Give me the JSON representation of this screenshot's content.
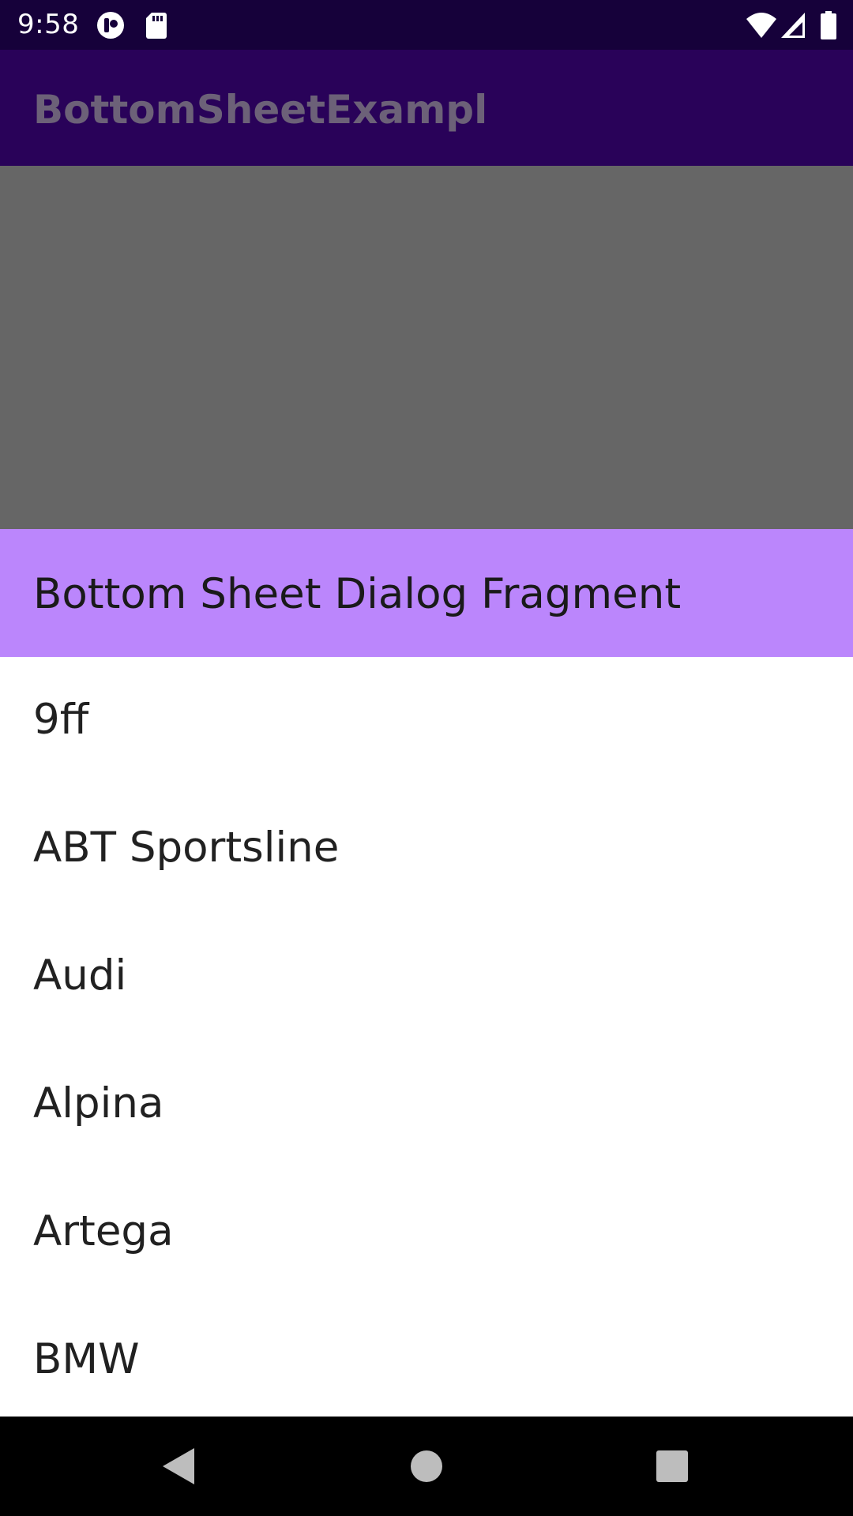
{
  "status_bar": {
    "time": "9:58",
    "left_icons": [
      "sync-app-icon",
      "sd-card-icon"
    ],
    "right_icons": [
      "wifi-icon",
      "cell-signal-icon",
      "battery-icon"
    ]
  },
  "app_bar": {
    "title": "BottomSheetExampl"
  },
  "sheet": {
    "title": "Bottom Sheet Dialog Fragment",
    "items": [
      {
        "label": "9ff"
      },
      {
        "label": "ABT Sportsline"
      },
      {
        "label": "Audi"
      },
      {
        "label": "Alpina"
      },
      {
        "label": "Artega"
      },
      {
        "label": "BMW"
      }
    ]
  },
  "nav_bar": {
    "buttons": [
      "back-icon",
      "home-icon",
      "recents-icon"
    ]
  },
  "colors": {
    "status_bar": "#16013a",
    "app_bar": "#290259",
    "scrim": "#666666",
    "sheet_header": "#bb86fc",
    "sheet_bg": "#ffffff",
    "nav_bar": "#000000"
  }
}
